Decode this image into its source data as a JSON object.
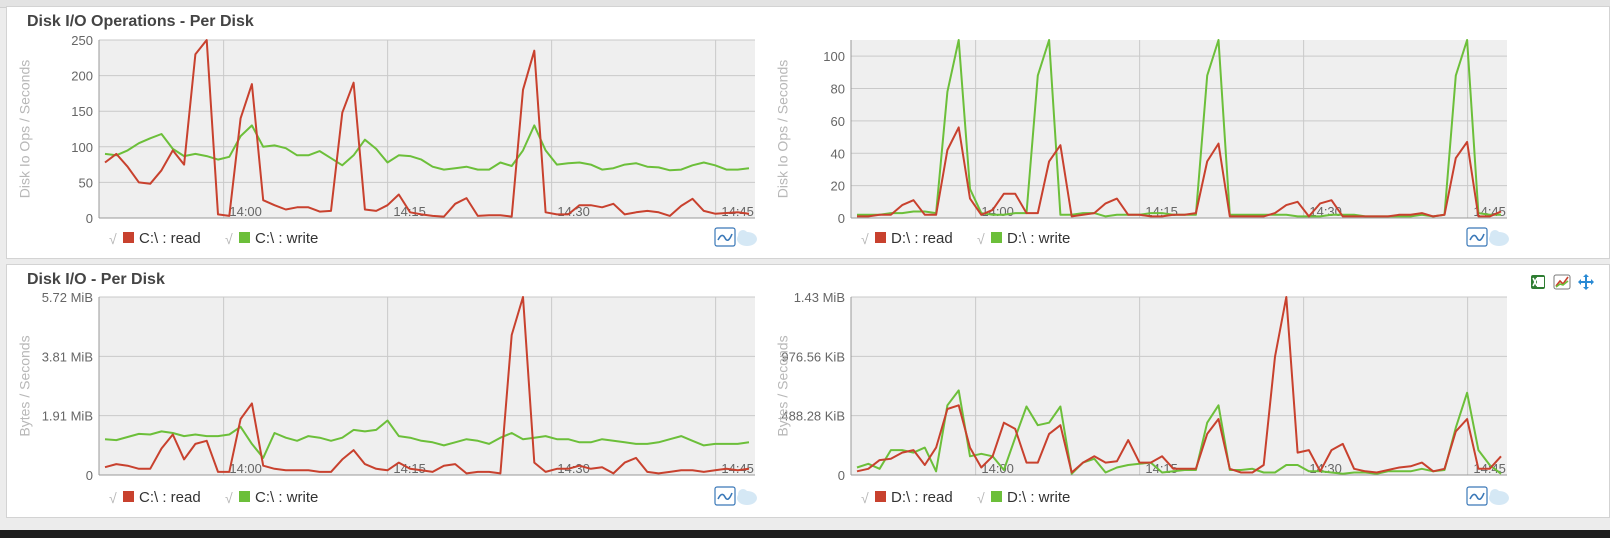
{
  "colors": {
    "read": "#c8412e",
    "write": "#6cbf3a",
    "plot_bg": "#efefef",
    "grid": "#c9c9c9",
    "text": "#666666",
    "ylabel": "#b8b8b8"
  },
  "panels": [
    {
      "title": "Disk I/O Operations - Per Disk",
      "toolbar": []
    },
    {
      "title": "Disk I/O - Per Disk",
      "toolbar": [
        "excel-export-icon",
        "chart-type-icon",
        "move-icon"
      ]
    }
  ],
  "chart_data": [
    {
      "type": "line",
      "ylabel": "Disk Io Ops / Seconds",
      "ylim": [
        0,
        250
      ],
      "yticks": [
        0,
        50,
        100,
        150,
        200,
        250
      ],
      "ytick_labels": [
        "0",
        "50",
        "100",
        "150",
        "200",
        "250"
      ],
      "xticks": [
        "14:00",
        "14:15",
        "14:30",
        "14:45"
      ],
      "series": [
        {
          "name": "C:\\ : read",
          "values": [
            78,
            90,
            72,
            50,
            48,
            67,
            95,
            75,
            230,
            252,
            5,
            3,
            140,
            188,
            25,
            18,
            12,
            15,
            15,
            9,
            10,
            148,
            190,
            12,
            10,
            18,
            33,
            8,
            5,
            3,
            2,
            20,
            28,
            3,
            4,
            4,
            2,
            180,
            235,
            8,
            5,
            5,
            18,
            18,
            15,
            20,
            5,
            8,
            10,
            8,
            3,
            17,
            27,
            10,
            6,
            7,
            8,
            6
          ]
        },
        {
          "name": "C:\\ : write",
          "values": [
            90,
            88,
            95,
            105,
            112,
            118,
            97,
            87,
            90,
            87,
            82,
            86,
            115,
            130,
            100,
            102,
            98,
            88,
            88,
            94,
            84,
            74,
            88,
            110,
            97,
            78,
            88,
            87,
            82,
            72,
            68,
            70,
            72,
            68,
            68,
            78,
            73,
            95,
            130,
            95,
            75,
            77,
            78,
            75,
            68,
            70,
            75,
            77,
            72,
            71,
            67,
            68,
            74,
            78,
            74,
            68,
            68,
            70
          ]
        }
      ]
    },
    {
      "type": "line",
      "ylabel": "Disk Io Ops / Seconds",
      "ylim": [
        0,
        110
      ],
      "yticks": [
        0,
        20,
        40,
        60,
        80,
        100
      ],
      "ytick_labels": [
        "0",
        "20",
        "40",
        "60",
        "80",
        "100"
      ],
      "xticks": [
        "14:00",
        "14:15",
        "14:30",
        "14:45"
      ],
      "series": [
        {
          "name": "D:\\ : read",
          "values": [
            1,
            1,
            2,
            2,
            8,
            11,
            2,
            2,
            42,
            56,
            12,
            2,
            5,
            15,
            15,
            3,
            3,
            35,
            45,
            1,
            2,
            3,
            9,
            12,
            2,
            2,
            1,
            1,
            2,
            2,
            3,
            35,
            46,
            1,
            1,
            1,
            1,
            3,
            8,
            10,
            1,
            9,
            11,
            1,
            1,
            1,
            1,
            1,
            2,
            2,
            3,
            1,
            2,
            37,
            47,
            1,
            1,
            4
          ]
        },
        {
          "name": "D:\\ : write",
          "values": [
            2,
            2,
            2,
            3,
            3,
            4,
            4,
            3,
            78,
            112,
            18,
            3,
            2,
            2,
            3,
            3,
            88,
            112,
            2,
            2,
            3,
            3,
            1,
            2,
            2,
            2,
            3,
            3,
            2,
            2,
            2,
            88,
            112,
            2,
            2,
            2,
            2,
            2,
            2,
            1,
            1,
            1,
            2,
            2,
            2,
            1,
            1,
            1,
            1,
            1,
            2,
            1,
            2,
            88,
            112,
            3,
            2,
            2
          ]
        }
      ]
    },
    {
      "type": "line",
      "ylabel": "Bytes / Seconds",
      "ylim": [
        0,
        5.72
      ],
      "yticks": [
        0,
        1.91,
        3.81,
        5.72
      ],
      "ytick_labels": [
        "0",
        "1.91 MiB",
        "3.81 MiB",
        "5.72 MiB"
      ],
      "xticks": [
        "14:00",
        "14:15",
        "14:30",
        "14:45"
      ],
      "series": [
        {
          "name": "C:\\ : read",
          "values": [
            0.25,
            0.35,
            0.3,
            0.2,
            0.2,
            0.85,
            1.3,
            0.5,
            1.0,
            1.1,
            0.1,
            0.1,
            1.8,
            2.3,
            0.3,
            0.2,
            0.15,
            0.15,
            0.15,
            0.1,
            0.1,
            0.5,
            0.8,
            0.35,
            0.2,
            0.15,
            0.4,
            0.2,
            0.15,
            0.1,
            0.3,
            0.35,
            0.05,
            0.1,
            0.1,
            0.05,
            4.5,
            6.0,
            0.4,
            0.1,
            0.2,
            0.2,
            0.3,
            0.2,
            0.25,
            0.05,
            0.4,
            0.55,
            0.1,
            0.05,
            0.1,
            0.15,
            0.15,
            0.1,
            0.15,
            0.2,
            0.15,
            0.2
          ]
        },
        {
          "name": "C:\\ : write",
          "values": [
            1.15,
            1.12,
            1.22,
            1.32,
            1.3,
            1.4,
            1.35,
            1.25,
            1.3,
            1.25,
            1.25,
            1.3,
            1.55,
            1.0,
            0.55,
            1.35,
            1.2,
            1.1,
            1.25,
            1.2,
            1.1,
            1.2,
            1.45,
            1.4,
            1.45,
            1.75,
            1.25,
            1.2,
            1.1,
            1.05,
            0.95,
            1.05,
            1.15,
            1.1,
            1.0,
            1.2,
            1.35,
            1.15,
            1.2,
            1.25,
            1.15,
            1.15,
            1.05,
            1.05,
            1.15,
            1.1,
            1.05,
            1.0,
            1.0,
            1.05,
            1.15,
            1.25,
            1.1,
            0.95,
            1.0,
            1.0,
            1.0,
            1.05
          ]
        }
      ]
    },
    {
      "type": "line",
      "ylabel": "Bytes / Seconds",
      "ylim": [
        0,
        1.43
      ],
      "yticks": [
        0,
        0.477,
        0.953,
        1.43
      ],
      "ytick_labels": [
        "0",
        "488.28 KiB",
        "976.56 KiB",
        "1.43 MiB"
      ],
      "xticks": [
        "14:00",
        "14:15",
        "14:30",
        "14:45"
      ],
      "series": [
        {
          "name": "D:\\ : read",
          "values": [
            0.03,
            0.05,
            0.12,
            0.13,
            0.18,
            0.2,
            0.08,
            0.22,
            0.53,
            0.56,
            0.22,
            0.06,
            0.15,
            0.42,
            0.37,
            0.1,
            0.1,
            0.33,
            0.4,
            0.02,
            0.1,
            0.15,
            0.1,
            0.11,
            0.28,
            0.1,
            0.1,
            0.15,
            0.05,
            0.05,
            0.05,
            0.33,
            0.45,
            0.05,
            0.02,
            0.02,
            0.08,
            0.95,
            1.43,
            0.18,
            0.2,
            0.03,
            0.2,
            0.25,
            0.05,
            0.03,
            0.02,
            0.04,
            0.06,
            0.07,
            0.1,
            0.03,
            0.05,
            0.35,
            0.45,
            0.05,
            0.05,
            0.15
          ]
        },
        {
          "name": "D:\\ : write",
          "values": [
            0.06,
            0.09,
            0.05,
            0.2,
            0.2,
            0.18,
            0.22,
            0.03,
            0.56,
            0.68,
            0.15,
            0.17,
            0.15,
            0.04,
            0.3,
            0.55,
            0.4,
            0.42,
            0.55,
            0.01,
            0.1,
            0.13,
            0.02,
            0.06,
            0.08,
            0.09,
            0.1,
            0.02,
            0.03,
            0.04,
            0.04,
            0.42,
            0.56,
            0.04,
            0.04,
            0.05,
            0.02,
            0.02,
            0.08,
            0.08,
            0.03,
            0.03,
            0.02,
            0.01,
            0.02,
            0.02,
            0.01,
            0.03,
            0.03,
            0.03,
            0.05,
            0.03,
            0.04,
            0.38,
            0.66,
            0.2,
            0.08,
            0.01
          ]
        }
      ]
    }
  ],
  "legend_check": "√",
  "chart_controls": [
    "chart-type-icon",
    "cloud-icon"
  ]
}
